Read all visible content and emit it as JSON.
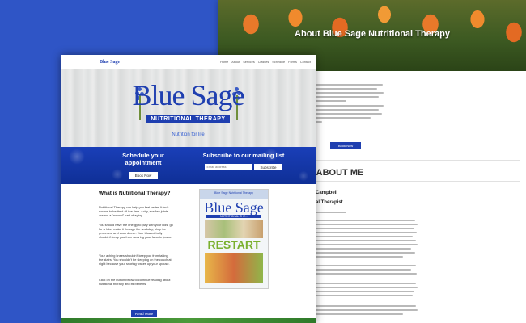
{
  "back_page": {
    "hero_title": "About Blue Sage Nutritional Therapy",
    "book_button": "Book Now",
    "about_heading": "ABOUT ME",
    "bio_name": "Campbell",
    "bio_role": "al Therapist"
  },
  "front_page": {
    "nav": {
      "logo": "Blue Sage",
      "links": [
        "Home",
        "About",
        "Services",
        "Classes",
        "Schedule",
        "Forms",
        "Contact"
      ]
    },
    "banner": {
      "logo_title": "Blue Sage",
      "logo_subtitle": "NUTRITIONAL THERAPY",
      "tagline": "Nutrition for life"
    },
    "appointment": {
      "heading": "Schedule your appointment",
      "button": "Book Now"
    },
    "mailing": {
      "heading": "Subscribe to our mailing list",
      "email_placeholder": "Email address",
      "button": "Subscribe"
    },
    "content": {
      "title": "What is Nutritional Therapy?",
      "p1": "Nutritional Therapy can help you feel better. It isn't normal to be tired all the time. Achy, swollen joints are not a \"normal\" part of aging.",
      "p2": "You should have the energy to play with your kids, go for a hike, make it through the workday, shop for groceries, and cook dinner. Your bloated belly shouldn't keep you from wearing your favorite jeans.",
      "p3": "Your aching knees shouldn't keep you from taking the stairs. You shouldn't be sleeping on the couch at night because your snoring wakes up your spouse.",
      "p4": "Click on the button below to continue reading about nutritional therapy and its benefits!",
      "read_more": "Read More"
    },
    "magazine": {
      "top": "Blue Sage Nutritional Therapy",
      "title": "Blue Sage",
      "subtitle": "NUTRITIONAL THE...",
      "headline": "RESTART"
    }
  }
}
